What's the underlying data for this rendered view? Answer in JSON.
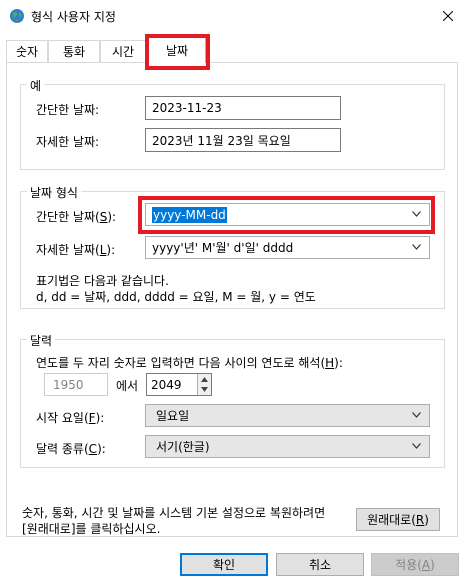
{
  "window": {
    "title": "형식 사용자 지정",
    "icon": "globe-icon",
    "close_icon": "close-icon"
  },
  "tabs": [
    {
      "label": "숫자",
      "active": false
    },
    {
      "label": "통화",
      "active": false
    },
    {
      "label": "시간",
      "active": false
    },
    {
      "label": "날짜",
      "active": true
    }
  ],
  "example": {
    "group_label": "예",
    "short_label": "간단한 날짜:",
    "short_value": "2023-11-23",
    "long_label": "자세한 날짜:",
    "long_value": "2023년 11월 23일 목요일"
  },
  "date_format": {
    "group_label": "날짜 형식",
    "short_label_pre": "간단한 날짜(",
    "short_label_key": "S",
    "short_label_post": "):",
    "short_value": "yyyy-MM-dd",
    "long_label_pre": "자세한 날짜(",
    "long_label_key": "L",
    "long_label_post": "):",
    "long_value": "yyyy'년' M'월' d'일' dddd",
    "notation_line1": "표기법은 다음과 같습니다.",
    "notation_line2": "d, dd = 날짜,  ddd, dddd = 요일,  M = 월,  y = 연도"
  },
  "calendar": {
    "group_label": "달력",
    "two_digit_pre": "연도를 두 자리 숫자로 입력하면 다음 사이의 연도로 해석(",
    "two_digit_key": "H",
    "two_digit_post": "):",
    "from_year": "1950",
    "between_text": "에서",
    "to_year": "2049",
    "first_day_label_pre": "시작 요일(",
    "first_day_label_key": "F",
    "first_day_label_post": "):",
    "first_day_value": "일요일",
    "calendar_type_label_pre": "달력 종류(",
    "calendar_type_label_key": "C",
    "calendar_type_label_post": "):",
    "calendar_type_value": "서기(한글)"
  },
  "restore": {
    "text_line1": "숫자, 통화, 시간 및 날짜를 시스템 기본 설정으로 복원하려면",
    "text_line2": "[원래대로]를 클릭하십시오.",
    "button_pre": "원래대로(",
    "button_key": "R",
    "button_post": ")"
  },
  "buttons": {
    "ok": "확인",
    "cancel": "취소",
    "apply_pre": "적용(",
    "apply_key": "A",
    "apply_post": ")"
  },
  "colors": {
    "highlight": "#e31b23",
    "selection": "#0078d7"
  }
}
